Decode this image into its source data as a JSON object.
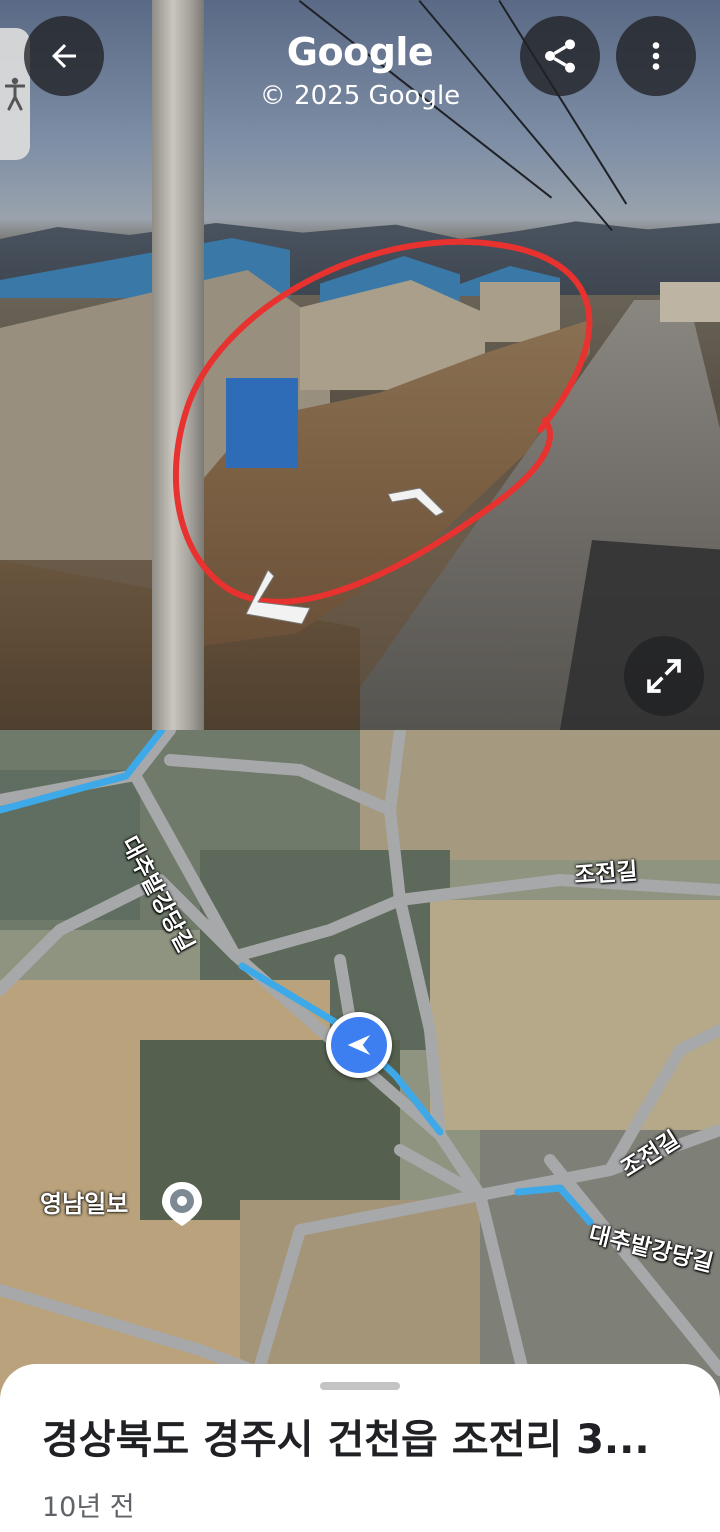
{
  "street_view": {
    "brand": "Google",
    "copyright": "© 2025 Google",
    "icons": {
      "back": "arrow-back-icon",
      "share": "share-icon",
      "more": "more-vert-icon",
      "expand": "fullscreen-icon",
      "accessibility": "accessibility-icon"
    },
    "annotation_color": "#e8322f"
  },
  "map": {
    "road_labels": [
      "대추밭강당길",
      "조전길",
      "조전길",
      "대추밭강당길"
    ],
    "poi": {
      "name": "영남일보"
    },
    "route_color": "#3da9e8",
    "location_color": "#3d7ef0"
  },
  "sheet": {
    "title": "경상북도 경주시 건천읍 조전리 3...",
    "age": "10년 전"
  }
}
